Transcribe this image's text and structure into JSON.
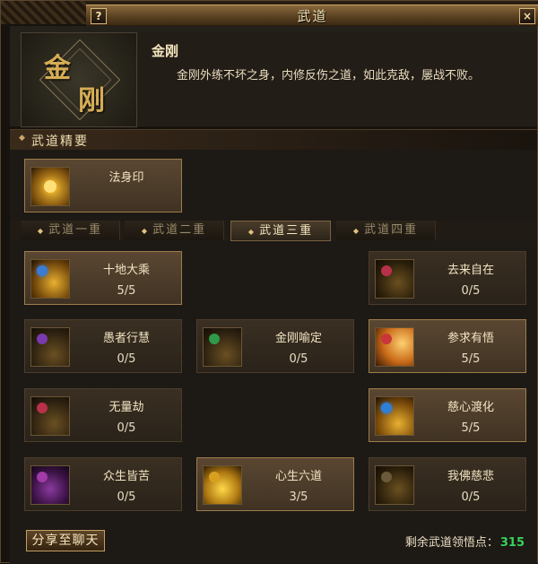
{
  "window": {
    "title": "武道",
    "help_label": "?",
    "close_label": "×"
  },
  "header": {
    "emblem_glyph_1": "金",
    "emblem_glyph_2": "刚",
    "name": "金刚",
    "description": "金刚外练不坏之身，内修反伤之道，如此克敌，屡战不败。"
  },
  "section": {
    "title": "武道精要"
  },
  "top_skill": {
    "name": "法身印",
    "icon": "golden-swirl-icon"
  },
  "tabs": [
    {
      "label": "武道一重",
      "active": false
    },
    {
      "label": "武道二重",
      "active": false
    },
    {
      "label": "武道三重",
      "active": true
    },
    {
      "label": "武道四重",
      "active": false
    }
  ],
  "skills": [
    {
      "name": "十地大乘",
      "progress": "5/5",
      "icon": "blue-orb-swirl-icon",
      "accent": "#3a7bd5"
    },
    {
      "name": "去来自在",
      "progress": "0/5",
      "icon": "red-orb-swirl-icon",
      "accent": "#b8304a"
    },
    {
      "name": "愚者行慧",
      "progress": "0/5",
      "icon": "purple-orb-chest-icon",
      "accent": "#7a3ab0"
    },
    {
      "name": "金刚喻定",
      "progress": "0/5",
      "icon": "green-orb-chest-icon",
      "accent": "#2f9a48"
    },
    {
      "name": "参求有悟",
      "progress": "5/5",
      "icon": "red-orb-flame-icon",
      "accent": "#c8363a"
    },
    {
      "name": "无量劫",
      "progress": "0/5",
      "icon": "red-orb-chest-icon",
      "accent": "#b8304a"
    },
    {
      "name": "慈心渡化",
      "progress": "5/5",
      "icon": "blue-orb-chest-icon",
      "accent": "#2f7ed8"
    },
    {
      "name": "众生皆苦",
      "progress": "0/5",
      "icon": "magenta-orb-tower-icon",
      "accent": "#a23aa8"
    },
    {
      "name": "心生六道",
      "progress": "3/5",
      "icon": "golden-figure-icon",
      "accent": "#d9a020"
    },
    {
      "name": "我佛慈悲",
      "progress": "0/5",
      "icon": "dark-orb-swirl-icon",
      "accent": "#6a5a3a"
    }
  ],
  "footer": {
    "share_label": "分享至聊天",
    "points_label": "剩余武道领悟点：",
    "points_value": "315"
  }
}
